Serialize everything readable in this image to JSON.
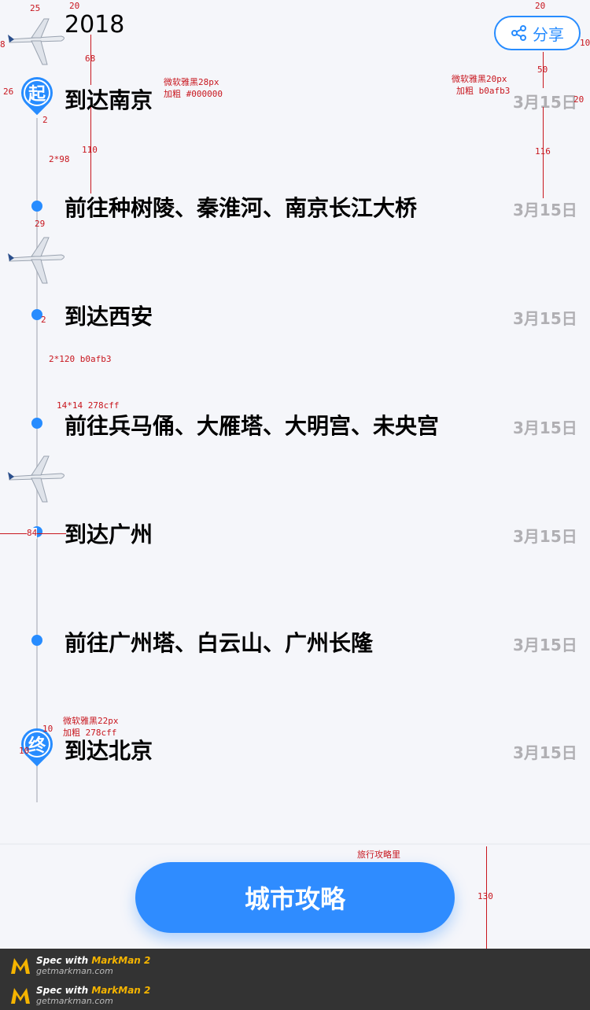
{
  "header": {
    "year": "2018",
    "share_label": "分享"
  },
  "timeline": [
    {
      "text": "到达南京",
      "date": "3月15日"
    },
    {
      "text": "前往种树陵、秦淮河、南京长江大桥",
      "date": "3月15日"
    },
    {
      "text": "到达西安",
      "date": "3月15日"
    },
    {
      "text": "前往兵马俑、大雁塔、大明宫、未央宫",
      "date": "3月15日"
    },
    {
      "text": "到达广州",
      "date": "3月15日"
    },
    {
      "text": "前往广州塔、白云山、广州长隆",
      "date": "3月15日"
    },
    {
      "text": "到达北京",
      "date": "3月15日"
    }
  ],
  "pins": {
    "start": "起",
    "end": "终"
  },
  "bottom": {
    "button_label": "城市攻略"
  },
  "annotations": {
    "font_title": "微软雅黑28px",
    "bold_title": "加粗 #000000",
    "font_date": "微软雅黑20px",
    "bold_date": "加粗 b0afb3",
    "line_top": "2*98",
    "line_mid": "2*120 b0afb3",
    "dot_size": "14*14 278cff",
    "font_pin": "微软雅黑22px",
    "bold_pin": "加粗 278cff",
    "button_note": "旅行攻略里",
    "m25": "25",
    "m20a": "20",
    "m20b": "20",
    "m68": "68",
    "m50": "50",
    "m110": "110",
    "m116": "116",
    "m29": "29",
    "m2a": "2",
    "m2b": "2",
    "m84": "84",
    "m10a": "10",
    "m10b": "10",
    "m26": "26",
    "m8": "8",
    "m10c": "10",
    "m20c": "20",
    "m130": "130"
  },
  "footer": {
    "line1_prefix": "Spec with ",
    "line1_brand": "MarkMan 2",
    "line1_site": "getmarkman.com",
    "line2_prefix": "Spec with ",
    "line2_brand": "MarkMan 2",
    "line2_site": "getmarkman.com"
  },
  "colors": {
    "accent": "#278cff",
    "date": "#b0afb3",
    "annotation": "#c8161e"
  }
}
